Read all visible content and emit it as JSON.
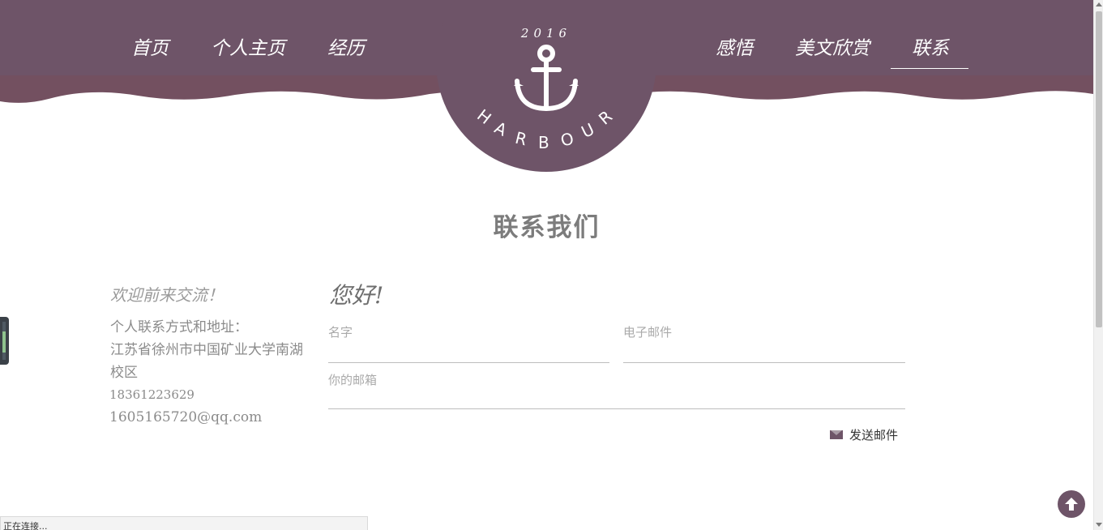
{
  "nav": {
    "left": [
      "首页",
      "个人主页",
      "经历"
    ],
    "right": [
      "感悟",
      "美文欣赏",
      "联系"
    ],
    "active": "联系"
  },
  "logo": {
    "year": "2016",
    "name": "HARBOUR",
    "icon": "anchor-icon"
  },
  "colors": {
    "header_top": "#6e5468",
    "header_bottom": "#735060",
    "accent": "#6e5468"
  },
  "section_title": "联系我们",
  "info": {
    "welcome": "欢迎前来交流！",
    "label": "个人联系方式和地址：",
    "address": "江苏省徐州市中国矿业大学南湖校区",
    "phone": "18361223629",
    "email": "1605165720@qq.com"
  },
  "form": {
    "greeting": "您好!",
    "name_placeholder": "名字",
    "email_placeholder": "电子邮件",
    "message_placeholder": "你的邮箱",
    "send_label": "发送邮件"
  },
  "status": "正在连接..."
}
